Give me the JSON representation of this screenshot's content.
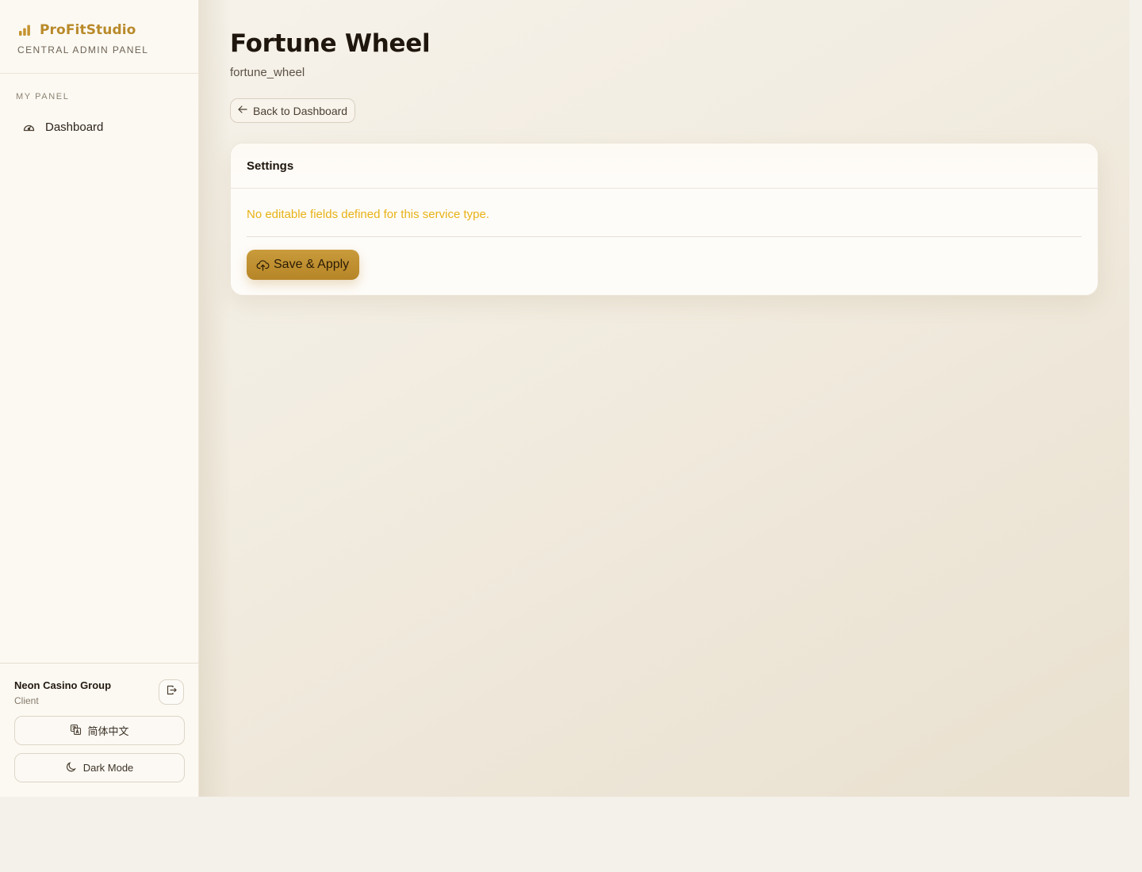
{
  "brand": {
    "name": "ProFitStudio",
    "subtitle": "CENTRAL ADMIN PANEL",
    "icon": "bar-chart-icon",
    "accent_color": "#b98a2a"
  },
  "sidebar": {
    "section_title": "MY PANEL",
    "items": [
      {
        "label": "Dashboard",
        "icon": "gauge-icon"
      }
    ]
  },
  "footer": {
    "user_name": "Neon Casino Group",
    "user_role": "Client",
    "logout_icon": "logout-icon",
    "language_label": "简体中文",
    "language_icon": "translate-icon",
    "theme_label": "Dark Mode",
    "theme_icon": "moon-icon"
  },
  "page": {
    "title": "Fortune Wheel",
    "slug": "fortune_wheel",
    "back_label": "Back to Dashboard",
    "back_icon": "arrow-left-icon"
  },
  "settings_card": {
    "title": "Settings",
    "empty_message": "No editable fields defined for this service type.",
    "empty_message_color": "#e7b215",
    "save_label": "Save & Apply",
    "save_icon": "cloud-upload-icon",
    "save_color": "#c0903a"
  }
}
